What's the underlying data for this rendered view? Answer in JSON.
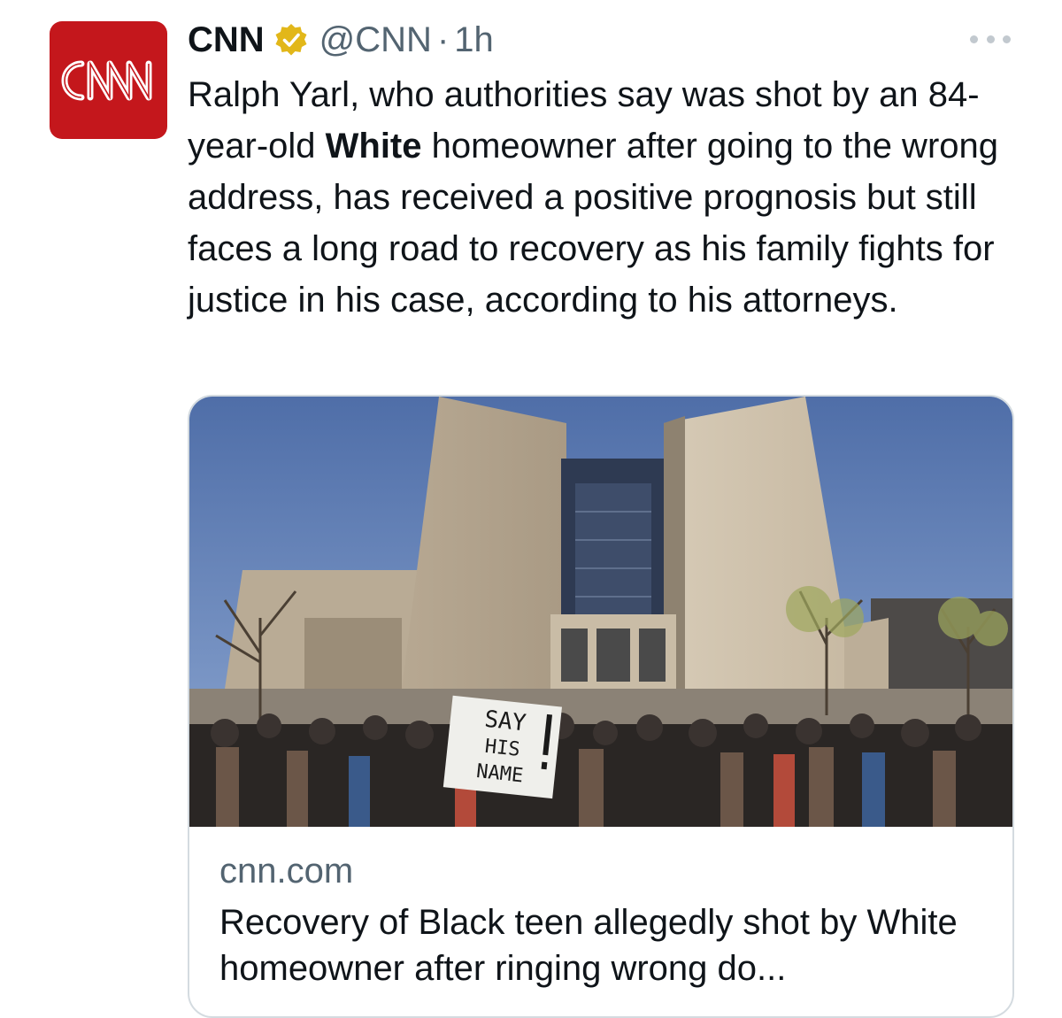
{
  "account": {
    "display_name": "CNN",
    "handle": "@CNN",
    "separator": "·",
    "timestamp": "1h",
    "avatar_logo_text": "CNN",
    "verified_icon": "verified-gold-badge-icon"
  },
  "menu": {
    "icon": "more-options-icon"
  },
  "tweet": {
    "text_part1": "Ralph Yarl, who authorities say was shot by an 84-year-old ",
    "text_bold": "White",
    "text_part2": " homeowner after going to the wrong address, has received a positive prognosis but still faces a long road to recovery as his family fights for justice in his case, according to his attorneys."
  },
  "link_card": {
    "domain": "cnn.com",
    "title": "Recovery of Black teen allegedly shot by White homeowner after ringing wrong do...",
    "image_sign_text": "SAY HIS NAME"
  },
  "colors": {
    "brand_red": "#c4171c",
    "verified_gold": "#e2b719",
    "secondary_text": "#536471",
    "card_border": "#d4dbe0"
  }
}
